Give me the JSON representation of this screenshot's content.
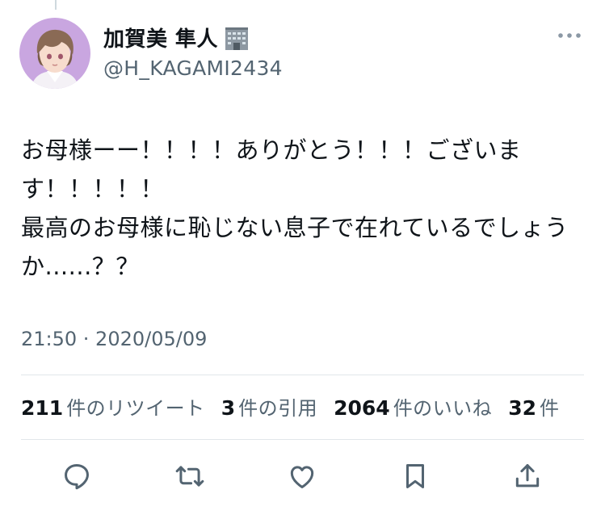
{
  "tweet": {
    "display_name": "加賀美 隼人",
    "handle": "@H_KAGAMI2434",
    "text": "お母様ーー！！！！ありがとう！！！ございます！！！！！\n最高のお母様に恥じない息子で在れているでしょうか......？？",
    "timestamp": "21:50 · 2020/05/09"
  },
  "stats": [
    {
      "count": "211",
      "label": "件のリツイート"
    },
    {
      "count": "3",
      "label": "件の引用"
    },
    {
      "count": "2064",
      "label": "件のいいね"
    },
    {
      "count": "32",
      "label": "件"
    }
  ],
  "icons": {
    "name_badge": "office-building-emoji",
    "more": "more-horizontal-icon",
    "actions": [
      "reply-icon",
      "retweet-icon",
      "like-icon",
      "bookmark-icon",
      "share-icon"
    ]
  },
  "colors": {
    "text": "#0f1419",
    "secondary": "#536471",
    "avatar_bg": "#c9a6e0",
    "divider": "#e1e6ea"
  }
}
